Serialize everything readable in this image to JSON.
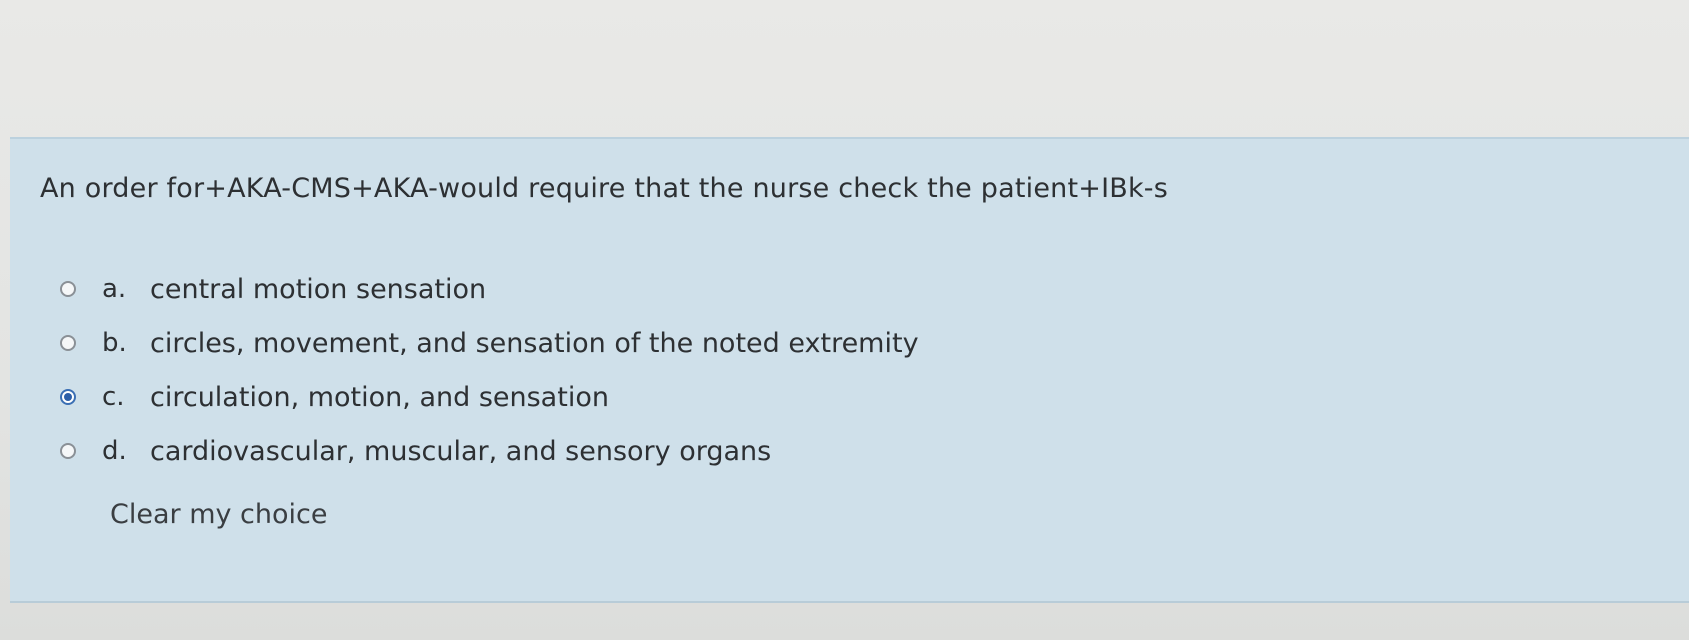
{
  "question": {
    "text": "An order for+AKA-CMS+AKA-would require that the nurse check the patient+IBk-s"
  },
  "answers": [
    {
      "letter": "a.",
      "text": "central motion sensation",
      "selected": false
    },
    {
      "letter": "b.",
      "text": "circles, movement, and sensation of the noted extremity",
      "selected": false
    },
    {
      "letter": "c.",
      "text": "circulation, motion, and sensation",
      "selected": true
    },
    {
      "letter": "d.",
      "text": "cardiovascular, muscular, and sensory organs",
      "selected": false
    }
  ],
  "clear_choice_label": "Clear my choice",
  "colors": {
    "card_background": "#cfe0ea",
    "selected_radio": "#2d5fa8",
    "text": "#2d3033"
  }
}
